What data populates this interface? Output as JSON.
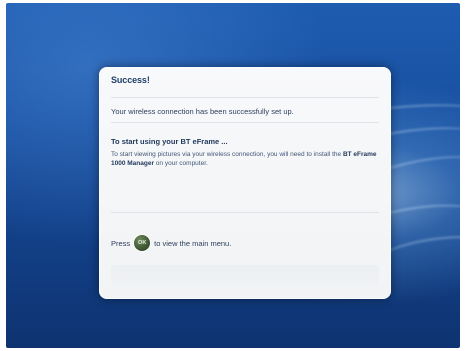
{
  "dialog": {
    "title": "Success!",
    "header_extra": "",
    "success_message": "Your wireless connection has been successfully set up.",
    "start_heading": "To start using your BT eFrame ...",
    "start_body_1": "To start viewing pictures via your wireless connection, you will need to install the ",
    "start_body_bold": "BT eFrame 1000 Manager",
    "start_body_2": " on your computer.",
    "press_prefix": "Press",
    "ok_label": "OK",
    "press_suffix": "to view the main menu."
  }
}
